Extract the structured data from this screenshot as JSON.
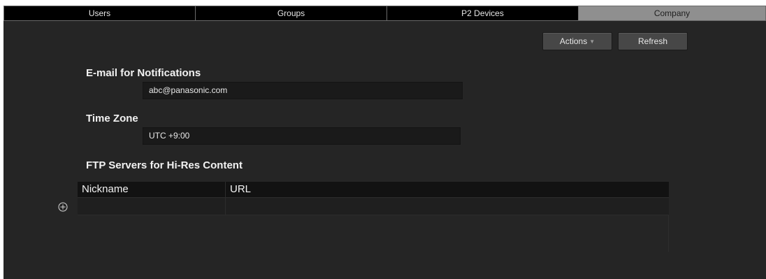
{
  "tabs": [
    {
      "label": "Users"
    },
    {
      "label": "Groups"
    },
    {
      "label": "P2 Devices"
    },
    {
      "label": "Company"
    }
  ],
  "active_tab": "Company",
  "toolbar": {
    "actions_label": "Actions",
    "refresh_label": "Refresh"
  },
  "email_section": {
    "heading": "E-mail for Notifications",
    "value": "abc@panasonic.com"
  },
  "timezone_section": {
    "heading": "Time Zone",
    "value": "UTC +9:00"
  },
  "ftp_section": {
    "heading": "FTP Servers for Hi-Res Content",
    "columns": [
      "Nickname",
      "URL"
    ],
    "rows": []
  },
  "icons": {
    "add": "add-circle-icon",
    "dropdown": "caret-down-icon"
  },
  "colors": {
    "background": "#252525",
    "active_tab": "#8f8f8f",
    "tab_bar": "#000000",
    "button": "#474747"
  }
}
